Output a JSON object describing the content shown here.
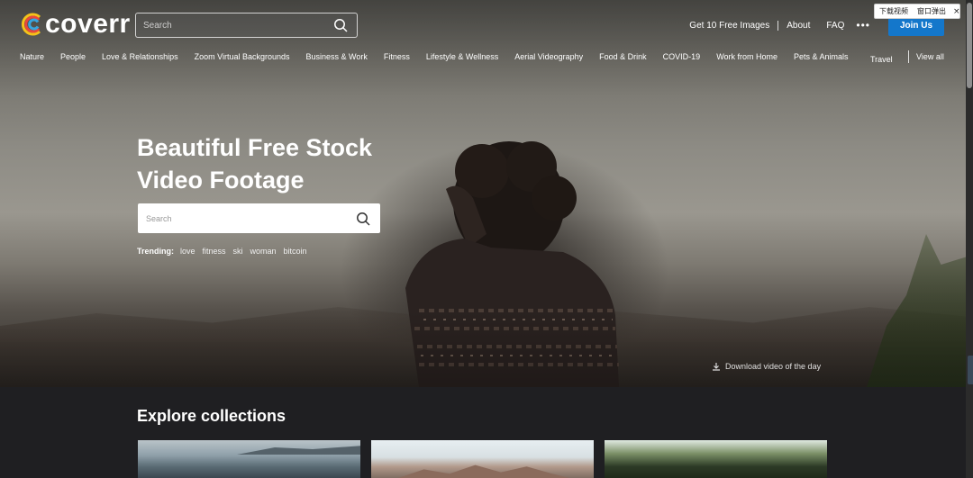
{
  "header": {
    "logo_text": "coverr",
    "search_placeholder": "Search",
    "links": [
      "Get 10 Free Images",
      "About",
      "FAQ"
    ],
    "more_label": "•••",
    "join_label": "Join Us"
  },
  "popup": {
    "download_label": "下载视频",
    "window_label": "窗口弹出",
    "close_label": "×"
  },
  "categories": [
    "Nature",
    "People",
    "Love & Relationships",
    "Zoom Virtual Backgrounds",
    "Business & Work",
    "Fitness",
    "Lifestyle & Wellness",
    "Aerial Videography",
    "Food & Drink",
    "COVID-19",
    "Work from Home",
    "Pets & Animals",
    "Travel &"
  ],
  "view_all_label": "View all",
  "hero": {
    "title_line1": "Beautiful Free Stock",
    "title_line2": "Video Footage",
    "search_placeholder": "Search",
    "trending_label": "Trending:",
    "trending_tags": [
      "love",
      "fitness",
      "ski",
      "woman",
      "bitcoin"
    ],
    "download_label": "Download video of the day"
  },
  "collections": {
    "title": "Explore collections"
  },
  "colors": {
    "join_button": "#1477cb",
    "page_bg": "#1f1f22"
  }
}
